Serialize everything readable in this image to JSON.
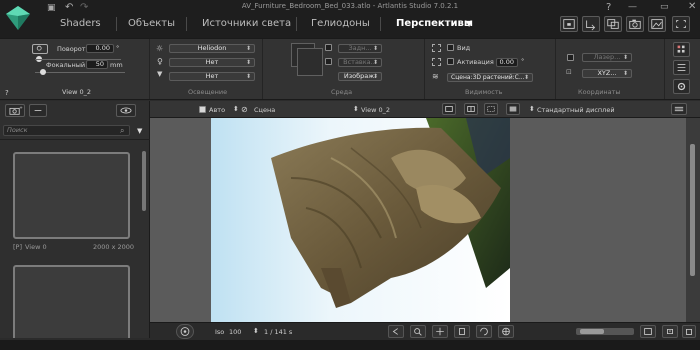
{
  "window": {
    "title": "AV_Furniture_Bedroom_Bed_033.atlo - Artlantis Studio 7.0.2.1"
  },
  "tabs": [
    {
      "label": "Shaders"
    },
    {
      "label": "Объекты"
    },
    {
      "label": "Источники света"
    },
    {
      "label": "Гелиодоны"
    },
    {
      "label": "Перспективы"
    }
  ],
  "colors": {
    "accent": "#3fbf9a",
    "window_bg": "#1e1e1e",
    "panel_bg": "#333333",
    "viewport_bg": "#5b5b5b"
  },
  "camera": {
    "rotation_label": "Поворот",
    "rotation_value": "0.00",
    "rotation_unit": "°",
    "focal_label": "Фокальный",
    "focal_value": "50",
    "focal_unit": "mm",
    "view_name": "View 0_2"
  },
  "lighting": {
    "heliodon": "Heliodon",
    "lights_1": "Нет",
    "lights_2": "Нет",
    "section_label": "Освещение"
  },
  "environment": {
    "foreground": "Задн...",
    "insert": "Вставка...",
    "image": "Изображ.",
    "section_label": "Среда"
  },
  "visibility": {
    "view_label": "Вид",
    "animation_label": "Активация",
    "animation_value": "0.00",
    "animation_unit": "°",
    "scene": "Сцена:3D растений:С...",
    "section_label": "Видимость"
  },
  "coordinates": {
    "laser": "Лазер...",
    "xyz": "XYZ...",
    "section_label": "Координаты"
  },
  "help_symbol": "?",
  "sidebar": {
    "search_placeholder": "Поиск",
    "items": [
      {
        "tag": "[P]",
        "name": "View 0",
        "size": "2000 x 2000"
      }
    ]
  },
  "viewbar": {
    "auto_label": "Авто",
    "scene_label": "Сцена",
    "view_label": "View 0_2",
    "display_label": "Стандартный дисплей"
  },
  "bottombar": {
    "iso_label": "Iso",
    "iso_value": "100",
    "shutter": "1 / 141 s"
  }
}
